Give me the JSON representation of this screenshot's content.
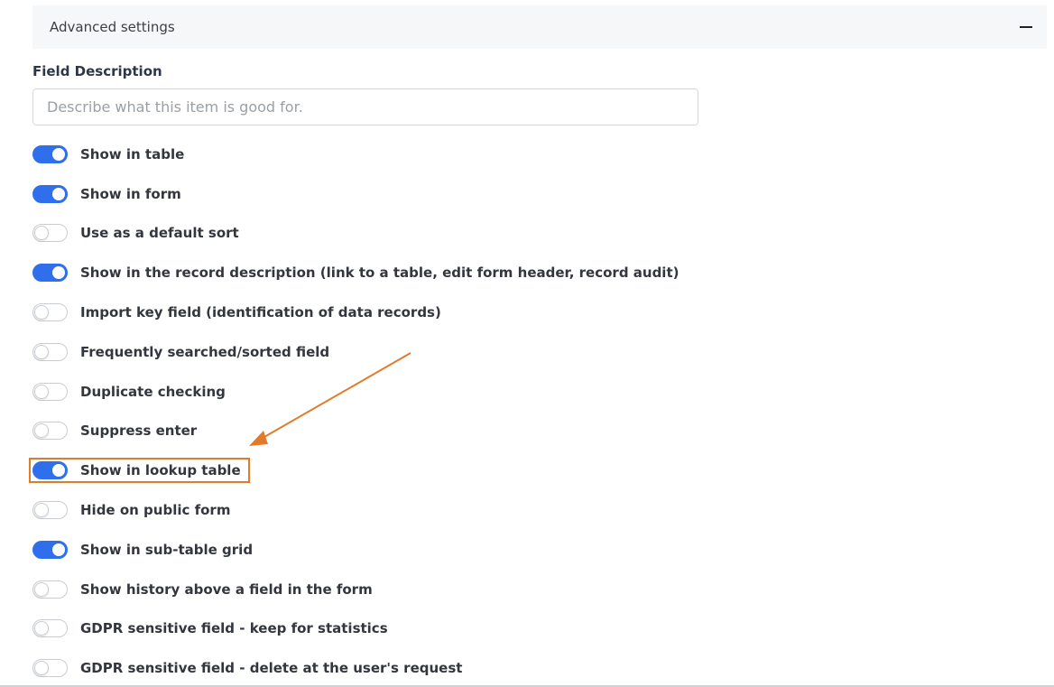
{
  "section": {
    "title": "Advanced settings",
    "collapse_icon": "minus-icon"
  },
  "field_description": {
    "label": "Field Description",
    "placeholder": "Describe what this item is good for.",
    "value": ""
  },
  "toggles": [
    {
      "label": "Show in table",
      "checked": true
    },
    {
      "label": "Show in form",
      "checked": true
    },
    {
      "label": "Use as a default sort",
      "checked": false
    },
    {
      "label": "Show in the record description (link to a table, edit form header, record audit)",
      "checked": true
    },
    {
      "label": "Import key field (identification of data records)",
      "checked": false
    },
    {
      "label": "Frequently searched/sorted field",
      "checked": false
    },
    {
      "label": "Duplicate checking",
      "checked": false
    },
    {
      "label": "Suppress enter",
      "checked": false
    },
    {
      "label": "Show in lookup table",
      "checked": true,
      "highlighted": true
    },
    {
      "label": "Hide on public form",
      "checked": false
    },
    {
      "label": "Show in sub-table grid",
      "checked": true
    },
    {
      "label": "Show history above a field in the form",
      "checked": false
    },
    {
      "label": "GDPR sensitive field - keep for statistics",
      "checked": false
    },
    {
      "label": "GDPR sensitive field - delete at the user's request",
      "checked": false
    }
  ],
  "colors": {
    "toggle_on": "#2f6fec",
    "annotation": "#e07b2c",
    "header_bg": "#f6f7f9"
  }
}
